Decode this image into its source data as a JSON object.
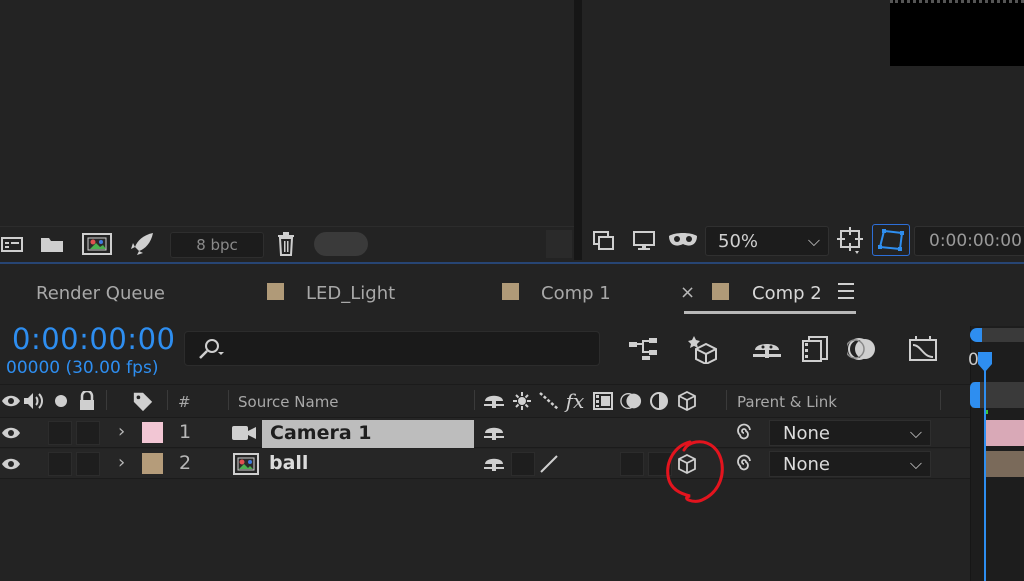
{
  "project_toolbar": {
    "bpc_label": "8 bpc",
    "icons": [
      "interpret-footage-icon",
      "new-folder-icon",
      "new-composition-icon",
      "render-icon",
      "delete-icon"
    ]
  },
  "viewer_toolbar": {
    "zoom": "50%",
    "timecode": "0:00:00:00",
    "icons": [
      "snapshot-icon",
      "monitor-icon",
      "mask-visibility-icon",
      "zoom-dropdown",
      "safe-zones-icon",
      "region-of-interest-icon"
    ]
  },
  "tabs": [
    {
      "label": "Render Queue",
      "swatch": false
    },
    {
      "label": "LED_Light",
      "swatch": true
    },
    {
      "label": "Comp 1",
      "swatch": true
    },
    {
      "label": "Comp 2",
      "swatch": true,
      "active": true
    }
  ],
  "timeline": {
    "timecode": "0:00:00:00",
    "fps_readout": "00000 (30.00 fps)",
    "search_placeholder": "",
    "ruler_label": "0s"
  },
  "columns": {
    "number": "#",
    "source_name": "Source Name",
    "parent_link": "Parent & Link"
  },
  "layers": [
    {
      "index": "1",
      "name": "Camera 1",
      "type": "camera",
      "label_color": "#f2c6d4",
      "parent": "None",
      "selected_name": true
    },
    {
      "index": "2",
      "name": "ball",
      "type": "composition",
      "label_color": "#b59c7a",
      "parent": "None",
      "three_d": true
    }
  ],
  "colors": {
    "accent_blue": "#2e8ef0",
    "annotation_red": "#e3141e"
  }
}
